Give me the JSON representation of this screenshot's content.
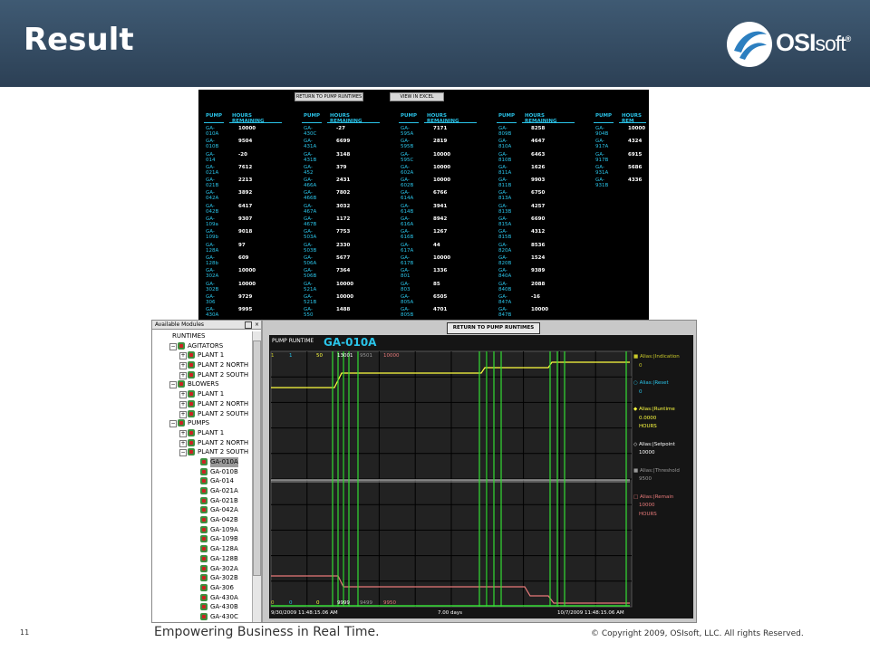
{
  "slide": {
    "title": "Result",
    "logo_main": "OSI",
    "logo_rest": "soft",
    "logo_reg": "®",
    "page_number": "11",
    "tagline": "Empowering Business in Real Time.",
    "copyright": "© Copyright 2009, OSIsoft, LLC. All rights Reserved."
  },
  "top_screen": {
    "btn_return": "RETURN TO PUMP RUNTIMES",
    "btn_excel": "VIEW IN EXCEL",
    "col_pump": "PUMP",
    "col_hours": "HOURS REMAINING",
    "col_hours_cut": "HOURS REM",
    "columns": [
      [
        [
          "GA-010A",
          "10000"
        ],
        [
          "GA-010B",
          "9504"
        ],
        [
          "GA-014",
          "-20"
        ],
        [
          "GA-021A",
          "7612"
        ],
        [
          "GA-021B",
          "2213"
        ],
        [
          "GA-042A",
          "3892"
        ],
        [
          "GA-042B",
          "6417"
        ],
        [
          "GA-109a",
          "9307"
        ],
        [
          "GA-109b",
          "9018"
        ],
        [
          "GA-128A",
          "97"
        ],
        [
          "GA-128b",
          "609"
        ],
        [
          "GA-302A",
          "10000"
        ],
        [
          "GA-302B",
          "10000"
        ],
        [
          "GA-306",
          "9729"
        ],
        [
          "GA-430A",
          "9995"
        ]
      ],
      [
        [
          "GA-430C",
          "-27"
        ],
        [
          "GA-431A",
          "6699"
        ],
        [
          "GA-431B",
          "3148"
        ],
        [
          "GA-452",
          "379"
        ],
        [
          "GA-466A",
          "2431"
        ],
        [
          "GA-466B",
          "7802"
        ],
        [
          "GA-467A",
          "3032"
        ],
        [
          "GA-467B",
          "1172"
        ],
        [
          "GA-503A",
          "7753"
        ],
        [
          "GA-503B",
          "2330"
        ],
        [
          "GA-506A",
          "5677"
        ],
        [
          "GA-506B",
          "7364"
        ],
        [
          "GA-521A",
          "10000"
        ],
        [
          "GA-521B",
          "10000"
        ],
        [
          "GA-550",
          "1488"
        ]
      ],
      [
        [
          "GA-595A",
          "7171"
        ],
        [
          "GA-595B",
          "2819"
        ],
        [
          "GA-595C",
          "10000"
        ],
        [
          "GA-602A",
          "10000"
        ],
        [
          "GA-602B",
          "10000"
        ],
        [
          "GA-614A",
          "6766"
        ],
        [
          "GA-614B",
          "3941"
        ],
        [
          "GA-616A",
          "8942"
        ],
        [
          "GA-616B",
          "1267"
        ],
        [
          "GA-617A",
          "44"
        ],
        [
          "GA-617B",
          "10000"
        ],
        [
          "GA-801",
          "1336"
        ],
        [
          "GA-803",
          "85"
        ],
        [
          "GA-805A",
          "6505"
        ],
        [
          "GA-805B",
          "4701"
        ]
      ],
      [
        [
          "GA-809B",
          "8258"
        ],
        [
          "GA-810A",
          "4647"
        ],
        [
          "GA-810B",
          "6463"
        ],
        [
          "GA-811A",
          "1626"
        ],
        [
          "GA-811B",
          "9903"
        ],
        [
          "GA-813A",
          "6750"
        ],
        [
          "GA-813B",
          "4257"
        ],
        [
          "GA-815A",
          "6690"
        ],
        [
          "GA-815B",
          "4312"
        ],
        [
          "GA-820A",
          "8536"
        ],
        [
          "GA-820B",
          "1524"
        ],
        [
          "GA-840A",
          "9389"
        ],
        [
          "GA-840B",
          "2088"
        ],
        [
          "GA-847A",
          "-16"
        ],
        [
          "GA-847B",
          "10000"
        ]
      ],
      [
        [
          "GA-904B",
          "10000"
        ],
        [
          "GA-917A",
          "4324"
        ],
        [
          "GA-917B",
          "6915"
        ],
        [
          "GA-931A",
          "5686"
        ],
        [
          "GA-931B",
          "4336"
        ]
      ]
    ]
  },
  "modules": {
    "header": "Available Modules",
    "close": "×",
    "tree": [
      {
        "label": "RUNTIMES",
        "level": 0,
        "exp": "",
        "icon": false
      },
      {
        "label": "AGITATORS",
        "level": 1,
        "exp": "−",
        "icon": true
      },
      {
        "label": "PLANT 1",
        "level": 2,
        "exp": "+",
        "icon": true
      },
      {
        "label": "PLANT 2 NORTH",
        "level": 2,
        "exp": "+",
        "icon": true
      },
      {
        "label": "PLANT 2 SOUTH",
        "level": 2,
        "exp": "+",
        "icon": true
      },
      {
        "label": "BLOWERS",
        "level": 1,
        "exp": "−",
        "icon": true
      },
      {
        "label": "PLANT 1",
        "level": 2,
        "exp": "+",
        "icon": true
      },
      {
        "label": "PLANT 2 NORTH",
        "level": 2,
        "exp": "+",
        "icon": true
      },
      {
        "label": "PLANT 2 SOUTH",
        "level": 2,
        "exp": "+",
        "icon": true
      },
      {
        "label": "PUMPS",
        "level": 1,
        "exp": "−",
        "icon": true
      },
      {
        "label": "PLANT 1",
        "level": 2,
        "exp": "+",
        "icon": true
      },
      {
        "label": "PLANT 2 NORTH",
        "level": 2,
        "exp": "+",
        "icon": true
      },
      {
        "label": "PLANT 2 SOUTH",
        "level": 2,
        "exp": "−",
        "icon": true
      },
      {
        "label": "GA-010A",
        "level": 3,
        "exp": "",
        "icon": true,
        "sel": true
      },
      {
        "label": "GA-010B",
        "level": 3,
        "exp": "",
        "icon": true
      },
      {
        "label": "GA-014",
        "level": 3,
        "exp": "",
        "icon": true
      },
      {
        "label": "GA-021A",
        "level": 3,
        "exp": "",
        "icon": true
      },
      {
        "label": "GA-021B",
        "level": 3,
        "exp": "",
        "icon": true
      },
      {
        "label": "GA-042A",
        "level": 3,
        "exp": "",
        "icon": true
      },
      {
        "label": "GA-042B",
        "level": 3,
        "exp": "",
        "icon": true
      },
      {
        "label": "GA-109A",
        "level": 3,
        "exp": "",
        "icon": true
      },
      {
        "label": "GA-109B",
        "level": 3,
        "exp": "",
        "icon": true
      },
      {
        "label": "GA-128A",
        "level": 3,
        "exp": "",
        "icon": true
      },
      {
        "label": "GA-128B",
        "level": 3,
        "exp": "",
        "icon": true
      },
      {
        "label": "GA-302A",
        "level": 3,
        "exp": "",
        "icon": true
      },
      {
        "label": "GA-302B",
        "level": 3,
        "exp": "",
        "icon": true
      },
      {
        "label": "GA-306",
        "level": 3,
        "exp": "",
        "icon": true
      },
      {
        "label": "GA-430A",
        "level": 3,
        "exp": "",
        "icon": true
      },
      {
        "label": "GA-430B",
        "level": 3,
        "exp": "",
        "icon": true
      },
      {
        "label": "GA-430C",
        "level": 3,
        "exp": "",
        "icon": true
      }
    ]
  },
  "trend": {
    "return_btn": "RETURN TO PUMP RUNTIMES",
    "plot_title": "PUMP RUNTIME",
    "pump_tag": "GA-010A",
    "top_vals": [
      {
        "t": "1",
        "c": "#c9c92a"
      },
      {
        "t": "1",
        "c": "#2ac3e8"
      },
      {
        "t": "50",
        "c": "#ffff40"
      },
      {
        "t": "13001",
        "c": "#ffffff"
      },
      {
        "t": "9501",
        "c": "#999999"
      },
      {
        "t": "10000",
        "c": "#e87a7a"
      }
    ],
    "bottom_vals": [
      {
        "t": "0",
        "c": "#c9c92a"
      },
      {
        "t": "0",
        "c": "#2ac3e8"
      },
      {
        "t": "0",
        "c": "#ffff40"
      },
      {
        "t": "9999",
        "c": "#ffffff"
      },
      {
        "t": "9499",
        "c": "#999999"
      },
      {
        "t": "9950",
        "c": "#e87a7a"
      }
    ],
    "start_time": "9/30/2009 11:48:15.06 AM",
    "span": "7.00 days",
    "end_time": "10/7/2009 11:48:15.06 AM",
    "legend": [
      {
        "text": "Alias:|Indication",
        "c": "#c9c92a",
        "marker": "■"
      },
      {
        "text": "0",
        "c": "#c9c92a",
        "marker": ""
      },
      {
        "text": "Alias:|Reset",
        "c": "#2ac3e8",
        "marker": "○"
      },
      {
        "text": "0",
        "c": "#2ac3e8",
        "marker": ""
      },
      {
        "text": "Alias:|Runtime",
        "c": "#ffff40",
        "marker": "◆"
      },
      {
        "text": "0.0000",
        "c": "#ffff40",
        "marker": ""
      },
      {
        "text": "HOURS",
        "c": "#ffff40",
        "marker": ""
      },
      {
        "text": "Alias:|Setpoint",
        "c": "#ffffff",
        "marker": "◇"
      },
      {
        "text": "10000",
        "c": "#ffffff",
        "marker": ""
      },
      {
        "text": "Alias:|Threshold",
        "c": "#999999",
        "marker": "■"
      },
      {
        "text": "9500",
        "c": "#999999",
        "marker": ""
      },
      {
        "text": "Alias:|Remain",
        "c": "#e87a7a",
        "marker": "□"
      },
      {
        "text": "10000",
        "c": "#e87a7a",
        "marker": ""
      },
      {
        "text": "HOURS",
        "c": "#e87a7a",
        "marker": ""
      }
    ]
  },
  "colors": {
    "header_bg": "#34495f",
    "cyan": "#2ac3e8",
    "runtime_yellow": "#ffff40",
    "indication_green": "#33dd33",
    "remain_pink": "#e87a7a",
    "setpoint_white": "#ffffff",
    "threshold_gray": "#999999"
  }
}
